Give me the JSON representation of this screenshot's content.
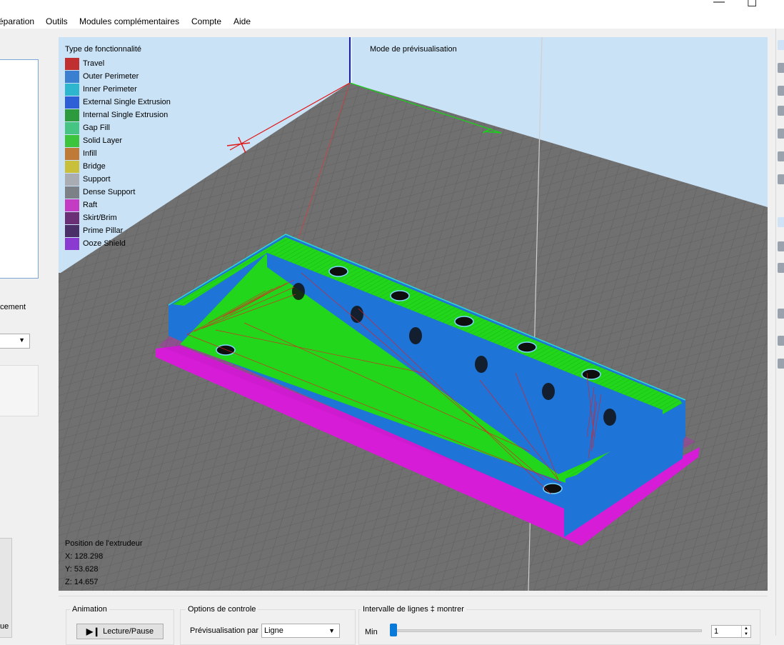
{
  "menu": {
    "items": [
      "éparation",
      "Outils",
      "Modules complémentaires",
      "Compte",
      "Aide"
    ],
    "minimize": "—",
    "maximize": "☐"
  },
  "left_panel": {
    "label": "cement",
    "bottom_text": "ue"
  },
  "viewport": {
    "legend": {
      "title": "Type de fonctionnalité",
      "items": [
        {
          "label": "Travel",
          "color": "#c03030"
        },
        {
          "label": "Outer Perimeter",
          "color": "#3a7fd0"
        },
        {
          "label": "Inner Perimeter",
          "color": "#2fb6cf"
        },
        {
          "label": "External Single Extrusion",
          "color": "#2f5fd6"
        },
        {
          "label": "Internal Single Extrusion",
          "color": "#2e9a3e"
        },
        {
          "label": "Gap Fill",
          "color": "#45c484"
        },
        {
          "label": "Solid Layer",
          "color": "#3cc43c"
        },
        {
          "label": "Infill",
          "color": "#c07a38"
        },
        {
          "label": "Bridge",
          "color": "#c8c03a"
        },
        {
          "label": "Support",
          "color": "#a9adb3"
        },
        {
          "label": "Dense Support",
          "color": "#7c8188"
        },
        {
          "label": "Raft",
          "color": "#c43cc4"
        },
        {
          "label": "Skirt/Brim",
          "color": "#6a2f74"
        },
        {
          "label": "Prime Pillar",
          "color": "#4a2f68"
        },
        {
          "label": "Ooze Shield",
          "color": "#8a3ad0"
        }
      ]
    },
    "preview_mode": "Mode de prévisualisation",
    "extruder": {
      "title": "Position de l'extrudeur",
      "x": "X: 128.298",
      "y": "Y: 53.628",
      "z": "Z: 14.657"
    },
    "colors": {
      "sky": "#c9e2f6",
      "bed": "#707070",
      "model_blue": "#1f74d8",
      "model_top": "#22d61c",
      "raft": "#d61cd6",
      "axis_x": "#e01818",
      "axis_y": "#18d418",
      "axis_z": "#1818d0"
    }
  },
  "bottom": {
    "animation": {
      "title": "Animation",
      "button": "Lecture/Pause"
    },
    "options": {
      "title": "Options de controle",
      "label": "Prévisualisation par",
      "value": "Ligne"
    },
    "interval": {
      "title": "Intervalle de lignes ‡ montrer",
      "min_label": "Min",
      "value": "1"
    }
  }
}
